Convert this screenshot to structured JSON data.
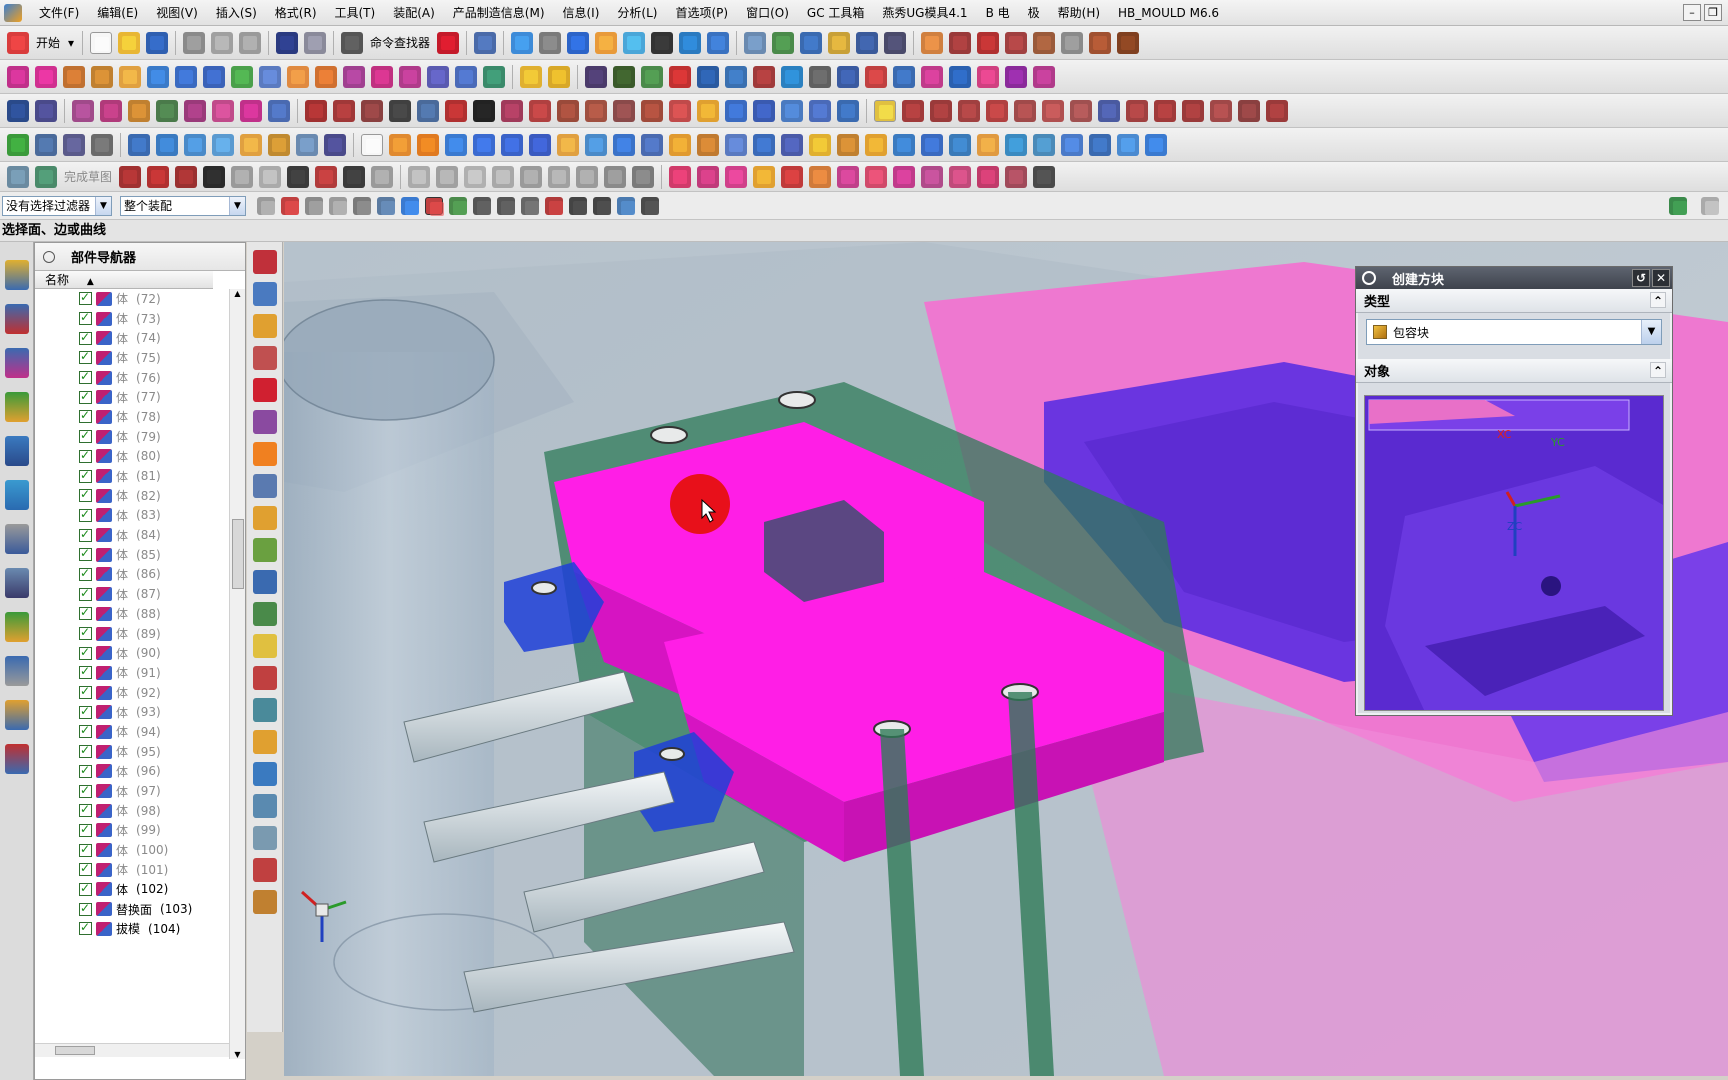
{
  "menu": {
    "items": [
      "文件(F)",
      "编辑(E)",
      "视图(V)",
      "插入(S)",
      "格式(R)",
      "工具(T)",
      "装配(A)",
      "产品制造信息(M)",
      "信息(I)",
      "分析(L)",
      "首选项(P)",
      "窗口(O)",
      "GC 工具箱",
      "燕秀UG模具4.1",
      "B 电",
      "极",
      "帮助(H)",
      "HB_MOULD M6.6"
    ]
  },
  "toolbar": {
    "start_label": "开始",
    "command_finder_label": "命令查找器",
    "finish_sketch_label": "完成草图"
  },
  "selection_bar": {
    "filter_value": "没有选择过滤器",
    "scope_value": "整个装配"
  },
  "cue_line": "选择面、边或曲线",
  "part_navigator": {
    "title": "部件导航器",
    "column_name": "名称",
    "rows": [
      {
        "label": "体",
        "index": "(72)",
        "active": false
      },
      {
        "label": "体",
        "index": "(73)",
        "active": false
      },
      {
        "label": "体",
        "index": "(74)",
        "active": false
      },
      {
        "label": "体",
        "index": "(75)",
        "active": false
      },
      {
        "label": "体",
        "index": "(76)",
        "active": false
      },
      {
        "label": "体",
        "index": "(77)",
        "active": false
      },
      {
        "label": "体",
        "index": "(78)",
        "active": false
      },
      {
        "label": "体",
        "index": "(79)",
        "active": false
      },
      {
        "label": "体",
        "index": "(80)",
        "active": false
      },
      {
        "label": "体",
        "index": "(81)",
        "active": false
      },
      {
        "label": "体",
        "index": "(82)",
        "active": false
      },
      {
        "label": "体",
        "index": "(83)",
        "active": false
      },
      {
        "label": "体",
        "index": "(84)",
        "active": false
      },
      {
        "label": "体",
        "index": "(85)",
        "active": false
      },
      {
        "label": "体",
        "index": "(86)",
        "active": false
      },
      {
        "label": "体",
        "index": "(87)",
        "active": false
      },
      {
        "label": "体",
        "index": "(88)",
        "active": false
      },
      {
        "label": "体",
        "index": "(89)",
        "active": false
      },
      {
        "label": "体",
        "index": "(90)",
        "active": false
      },
      {
        "label": "体",
        "index": "(91)",
        "active": false
      },
      {
        "label": "体",
        "index": "(92)",
        "active": false
      },
      {
        "label": "体",
        "index": "(93)",
        "active": false
      },
      {
        "label": "体",
        "index": "(94)",
        "active": false
      },
      {
        "label": "体",
        "index": "(95)",
        "active": false
      },
      {
        "label": "体",
        "index": "(96)",
        "active": false
      },
      {
        "label": "体",
        "index": "(97)",
        "active": false
      },
      {
        "label": "体",
        "index": "(98)",
        "active": false
      },
      {
        "label": "体",
        "index": "(99)",
        "active": false
      },
      {
        "label": "体",
        "index": "(100)",
        "active": false
      },
      {
        "label": "体",
        "index": "(101)",
        "active": false
      },
      {
        "label": "体",
        "index": "(102)",
        "active": true
      },
      {
        "label": "替换面",
        "index": "(103)",
        "active": true
      },
      {
        "label": "拔模",
        "index": "(104)",
        "active": true
      }
    ]
  },
  "dialog": {
    "title": "创建方块",
    "type_group_label": "类型",
    "type_value": "包容块",
    "object_group_label": "对象",
    "triad": {
      "xc": "XC",
      "yc": "YC",
      "zc": "ZC"
    }
  },
  "colors": {
    "magenta_part": "#ff1ee6",
    "pink_part": "#ee6fcf",
    "purple_part": "#6a2fe0",
    "green_plate": "#2f7b58",
    "blue_part": "#1e3fd8",
    "cursor_marker": "#e8101a"
  }
}
